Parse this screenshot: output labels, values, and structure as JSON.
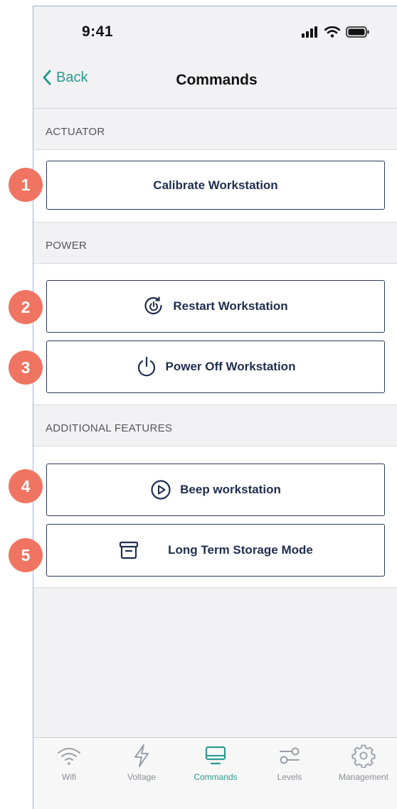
{
  "status_bar": {
    "time": "9:41"
  },
  "nav": {
    "back_label": "Back",
    "title": "Commands"
  },
  "sections": {
    "actuator": {
      "header": "ACTUATOR",
      "calibrate_label": "Calibrate Workstation"
    },
    "power": {
      "header": "POWER",
      "restart_label": "Restart Workstation",
      "power_off_label": "Power Off Workstation"
    },
    "additional": {
      "header": "ADDITIONAL FEATURES",
      "beep_label": "Beep workstation",
      "storage_label": "Long Term Storage Mode"
    }
  },
  "badges": [
    "1",
    "2",
    "3",
    "4",
    "5"
  ],
  "tab_bar": {
    "active": "Commands",
    "tabs": [
      {
        "label": "Wifi",
        "icon": "wifi-icon"
      },
      {
        "label": "Voltage",
        "icon": "lightning-icon"
      },
      {
        "label": "Commands",
        "icon": "monitor-icon"
      },
      {
        "label": "Levels",
        "icon": "sliders-icon"
      },
      {
        "label": "Management",
        "icon": "gear-icon"
      }
    ]
  },
  "colors": {
    "accent": "#2a9a8e",
    "badge": "#ef7562",
    "button_text": "#1f2d4e",
    "background": "#f2f2f4"
  }
}
